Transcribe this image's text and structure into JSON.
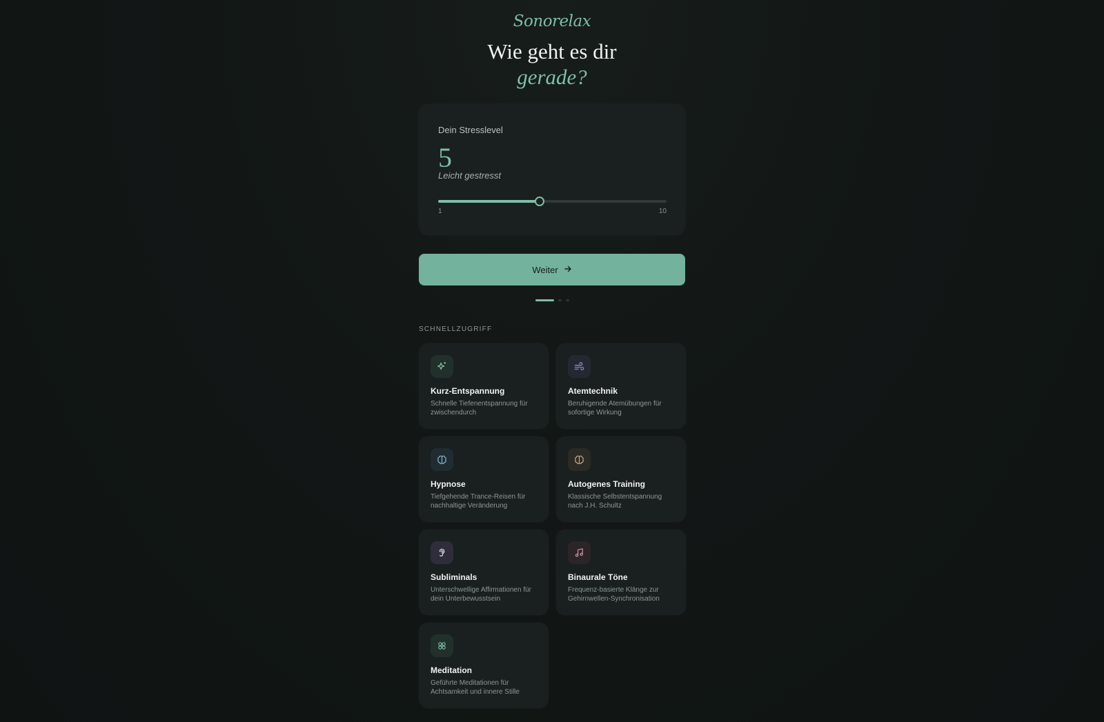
{
  "brand": "Sonorelax",
  "headline": {
    "line1": "Wie geht es dir",
    "line2_accent": "gerade?"
  },
  "stress": {
    "label": "Dein Stresslevel",
    "value": 5,
    "value_text": "5",
    "description": "Leicht gestresst",
    "min_label": "1",
    "max_label": "10",
    "min": 1,
    "max": 10
  },
  "cta": {
    "label": "Weiter"
  },
  "progress": {
    "steps": 3,
    "current": 1
  },
  "quick_access": {
    "title": "SCHNELLZUGRIFF",
    "tiles": [
      {
        "title": "Kurz-Entspannung",
        "description": "Schnelle Tiefenentspannung für zwischendurch",
        "icon": "sparkles-icon",
        "color": "#7dbfa6",
        "bg": "#21302b"
      },
      {
        "title": "Atemtechnik",
        "description": "Beruhigende Atemübungen für sofortige Wirkung",
        "icon": "wind-icon",
        "color": "#8b94c9",
        "bg": "#252833"
      },
      {
        "title": "Hypnose",
        "description": "Tiefgehende Trance-Reisen für nachhaltige Veränderung",
        "icon": "brain-icon",
        "color": "#7fb2c9",
        "bg": "#202c31"
      },
      {
        "title": "Autogenes Training",
        "description": "Klassische Selbstentspannung nach J.H. Schultz",
        "icon": "brain-icon",
        "color": "#c9a57f",
        "bg": "#2c2a25"
      },
      {
        "title": "Subliminals",
        "description": "Unterschwellige Affirmationen für dein Unterbewusstsein",
        "icon": "ear-icon",
        "color": "#d8d8e6",
        "bg": "#2f2d3c"
      },
      {
        "title": "Binaurale Töne",
        "description": "Frequenz-basierte Klänge zur Gehirnwellen-Synchronisation",
        "icon": "music-icon",
        "color": "#c98fa6",
        "bg": "#2c2528"
      },
      {
        "title": "Meditation",
        "description": "Geführte Meditationen für Achtsamkeit und innere Stille",
        "icon": "flower-icon",
        "color": "#7dbfa6",
        "bg": "#21302b"
      }
    ]
  }
}
